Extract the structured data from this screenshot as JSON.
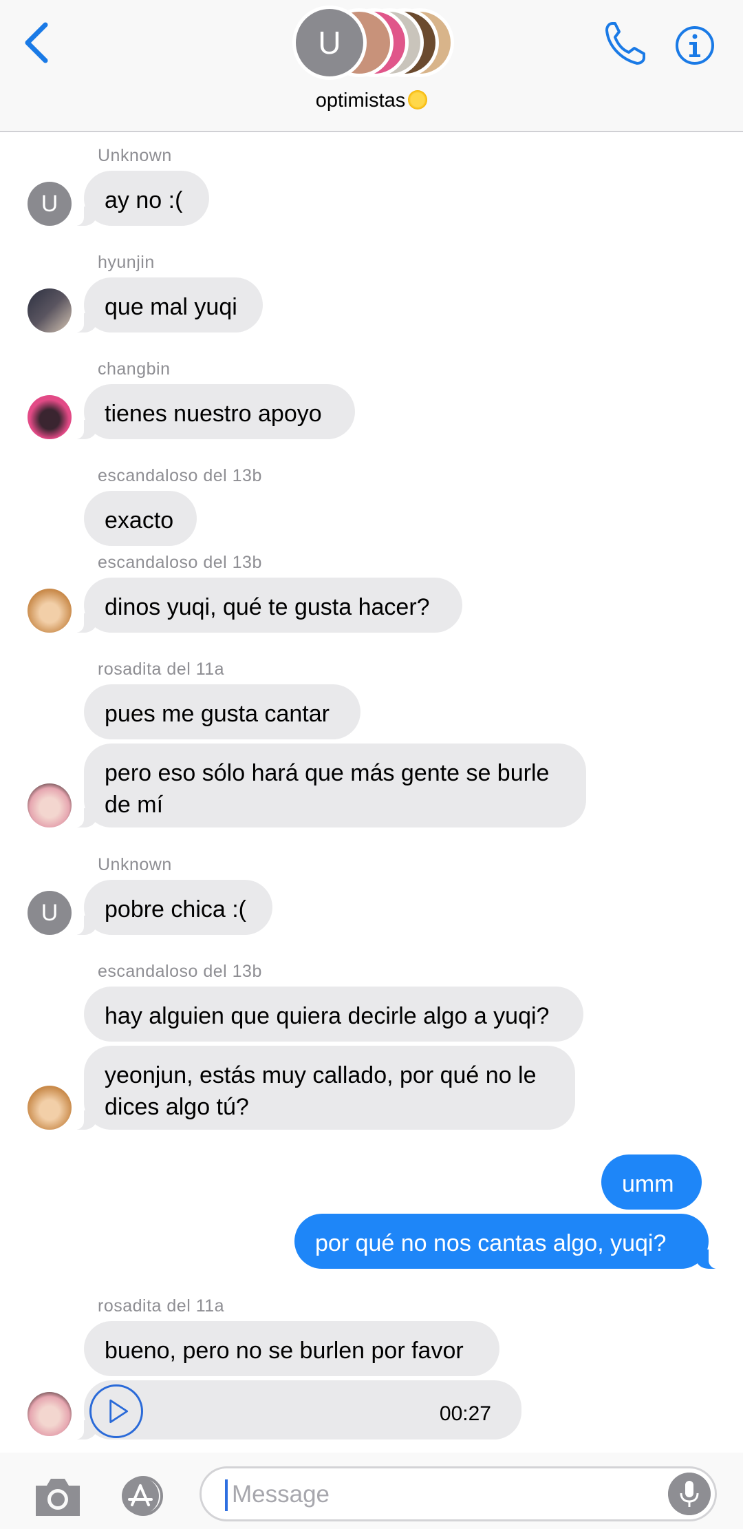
{
  "header": {
    "title": "optimistas",
    "group_initial": "U",
    "back_icon": "chevron-left-icon",
    "call_icon": "phone-icon",
    "info_icon": "info-icon",
    "accent": "#1a7ae6"
  },
  "messages": [
    {
      "sender": "Unknown",
      "avatar": "U",
      "bubbles": [
        "ay no :("
      ]
    },
    {
      "sender": "hyunjin",
      "bubbles": [
        "que mal yuqi"
      ]
    },
    {
      "sender": "changbin",
      "bubbles": [
        "tienes nuestro apoyo"
      ]
    },
    {
      "sender": "escandaloso del 13b",
      "bubbles": [
        "exacto"
      ]
    },
    {
      "sender": "escandaloso del 13b",
      "bubbles": [
        "dinos yuqi, qué te gusta hacer?"
      ]
    },
    {
      "sender": "rosadita del 11a",
      "bubbles": [
        "pues me gusta cantar",
        "pero eso sólo hará que más gente se burle de mí"
      ]
    },
    {
      "sender": "Unknown",
      "avatar": "U",
      "bubbles": [
        "pobre chica :("
      ]
    },
    {
      "sender": "escandaloso del 13b",
      "bubbles": [
        "hay alguien que quiera decirle algo a yuqi?",
        "yeonjun, estás muy callado, por qué no le dices algo tú?"
      ]
    },
    {
      "sender": "me",
      "bubbles": [
        "umm",
        "por qué no nos cantas algo, yuqi?"
      ]
    },
    {
      "sender": "rosadita del 11a",
      "bubbles": [
        "bueno, pero no se burlen por favor"
      ],
      "audio": {
        "duration": "00:27",
        "icon": "play-icon"
      }
    }
  ],
  "input": {
    "placeholder": "Message",
    "camera_icon": "camera-icon",
    "apps_icon": "app-store-icon",
    "mic_icon": "microphone-icon"
  },
  "colors": {
    "incoming_bubble": "#e9e9eb",
    "outgoing_bubble": "#1e86f8",
    "sender_label": "#8e8e93"
  }
}
